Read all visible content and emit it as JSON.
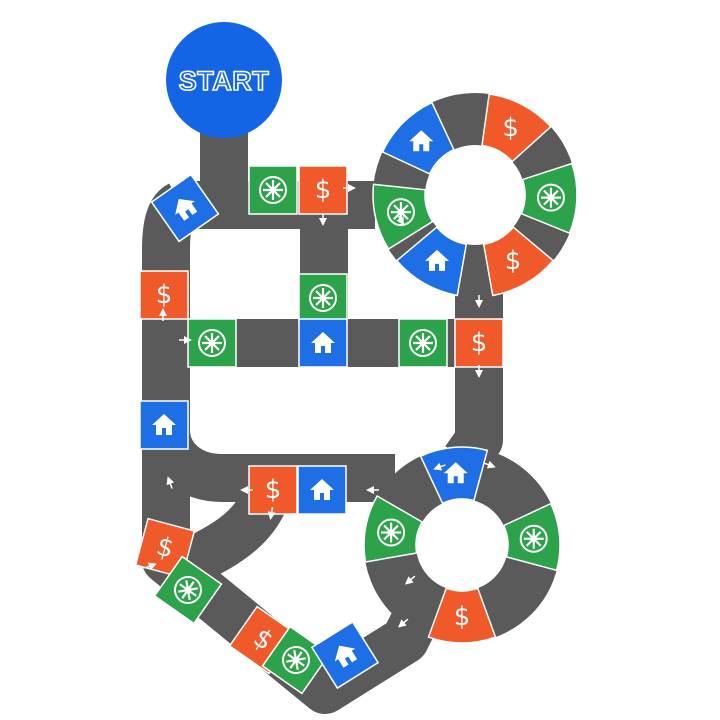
{
  "start_label": "START",
  "colors": {
    "track": "#5a5a5a",
    "money": "#f05a2a",
    "house": "#1e6ee6",
    "spin": "#2ca24a",
    "start": "#1464e6",
    "edge": "#ffffff"
  },
  "tile_symbols": {
    "money": "$"
  },
  "icons": {
    "money": "dollar-icon",
    "house": "house-icon",
    "spin": "spinner-wheel-icon",
    "arrow": "arrow-icon"
  }
}
